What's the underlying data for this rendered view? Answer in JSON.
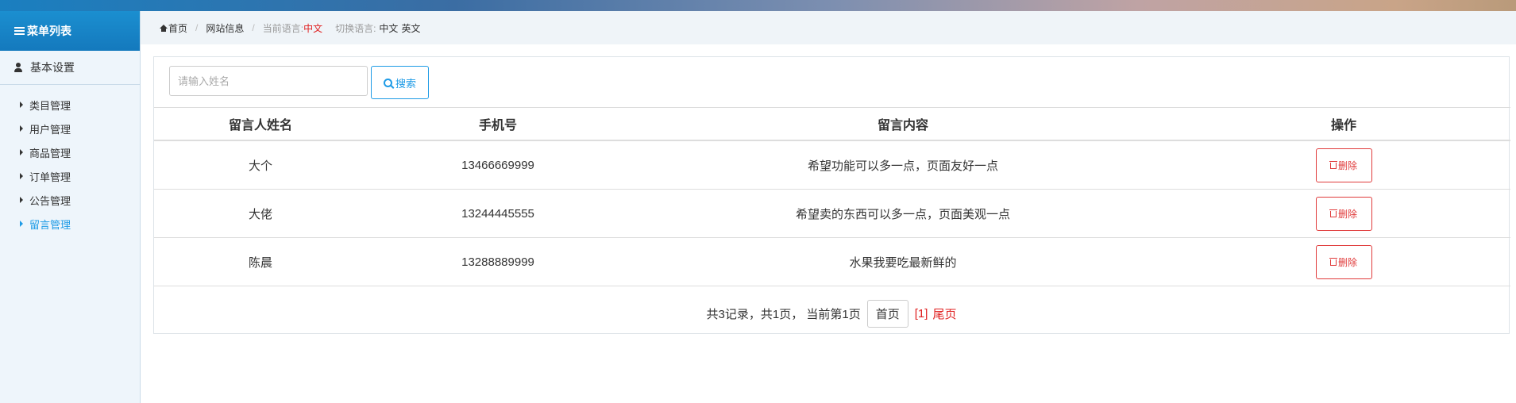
{
  "sidebar": {
    "menu_title": "菜单列表",
    "group_title": "基本设置",
    "items": [
      {
        "label": "类目管理"
      },
      {
        "label": "用户管理"
      },
      {
        "label": "商品管理"
      },
      {
        "label": "订单管理"
      },
      {
        "label": "公告管理"
      },
      {
        "label": "留言管理",
        "active": true
      }
    ]
  },
  "breadcrumb": {
    "home": "首页",
    "site_info": "网站信息",
    "current_lang_label": "当前语言:",
    "current_lang": "中文",
    "switch_label": "切换语言:",
    "lang_zh": "中文",
    "lang_en": "英文"
  },
  "search": {
    "placeholder": "请输入姓名",
    "value": "",
    "button_label": "搜索"
  },
  "table": {
    "columns": [
      "留言人姓名",
      "手机号",
      "留言内容",
      "操作"
    ],
    "rows": [
      {
        "name": "大个",
        "phone": "13466669999",
        "content": "希望功能可以多一点，页面友好一点",
        "action": "删除"
      },
      {
        "name": "大佬",
        "phone": "13244445555",
        "content": "希望卖的东西可以多一点，页面美观一点",
        "action": "删除"
      },
      {
        "name": "陈晨",
        "phone": "13288889999",
        "content": "水果我要吃最新鲜的",
        "action": "删除"
      }
    ]
  },
  "pager": {
    "summary": "共3记录，共1页， 当前第1页",
    "first": "首页",
    "current": "[1]",
    "last": "尾页"
  },
  "colors": {
    "accent": "#1e9be6",
    "danger": "#e03b3b",
    "sidebar_header": "#1479bd"
  },
  "icons": [
    "menu-icon",
    "user-icon",
    "home-icon",
    "search-icon",
    "trash-icon"
  ]
}
